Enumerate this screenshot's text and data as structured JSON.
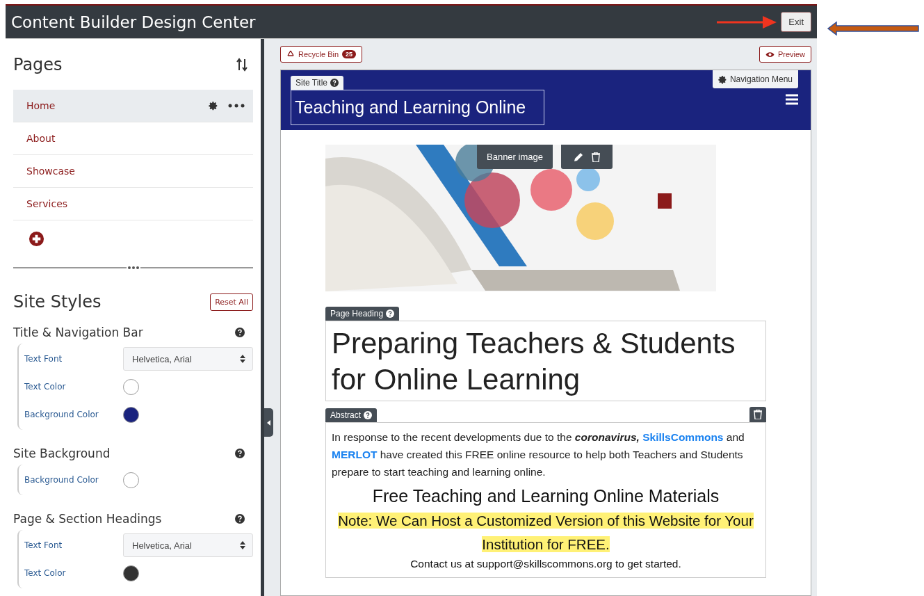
{
  "window": {
    "title": "Content Builder Design Center",
    "exit_button": "Exit"
  },
  "pages_panel": {
    "title": "Pages",
    "items": [
      {
        "label": "Home",
        "selected": true
      },
      {
        "label": "About",
        "selected": false
      },
      {
        "label": "Showcase",
        "selected": false
      },
      {
        "label": "Services",
        "selected": false
      }
    ]
  },
  "site_styles": {
    "title": "Site Styles",
    "reset_button": "Reset All",
    "groups": [
      {
        "title": "Title & Navigation Bar",
        "settings": [
          {
            "kind": "font",
            "label": "Text Font",
            "value": "Helvetica, Arial"
          },
          {
            "kind": "color",
            "label": "Text Color",
            "color": "#ffffff"
          },
          {
            "kind": "color",
            "label": "Background Color",
            "color": "#1a237e"
          }
        ]
      },
      {
        "title": "Site Background",
        "settings": [
          {
            "kind": "color",
            "label": "Background Color",
            "color": "#ffffff"
          }
        ]
      },
      {
        "title": "Page & Section Headings",
        "settings": [
          {
            "kind": "font",
            "label": "Text Font",
            "value": "Helvetica, Arial"
          },
          {
            "kind": "color",
            "label": "Text Color",
            "color": "#333333"
          }
        ]
      }
    ]
  },
  "editor": {
    "recycle_bin": {
      "label": "Recycle Bin",
      "count": "25"
    },
    "preview_button": "Preview",
    "site_title_label": "Site Title",
    "site_title": "Teaching and Learning Online",
    "navigation_menu_button": "Navigation Menu",
    "banner_label": "Banner image",
    "page_heading_label": "Page Heading",
    "page_heading": "Preparing Teachers & Students for Online Learning",
    "abstract_label": "Abstract",
    "abstract_parts": [
      {
        "kind": "text",
        "text": "In response to the recent developments due to the "
      },
      {
        "kind": "emphasis",
        "text": "coronavirus, "
      },
      {
        "kind": "link",
        "text": "SkillsCommons"
      },
      {
        "kind": "text",
        "text": " and "
      },
      {
        "kind": "link",
        "text": "MERLOT"
      },
      {
        "kind": "text",
        "text": " have created this FREE online resource to help both Teachers and Students prepare to start teaching and learning online."
      }
    ],
    "materials_heading": "Free Teaching and Learning Online Materials",
    "note": "Note: We Can Host a Customized Version of this Website for Your Institution for FREE.",
    "contact": "Contact us at support@skillscommons.org to get started."
  }
}
